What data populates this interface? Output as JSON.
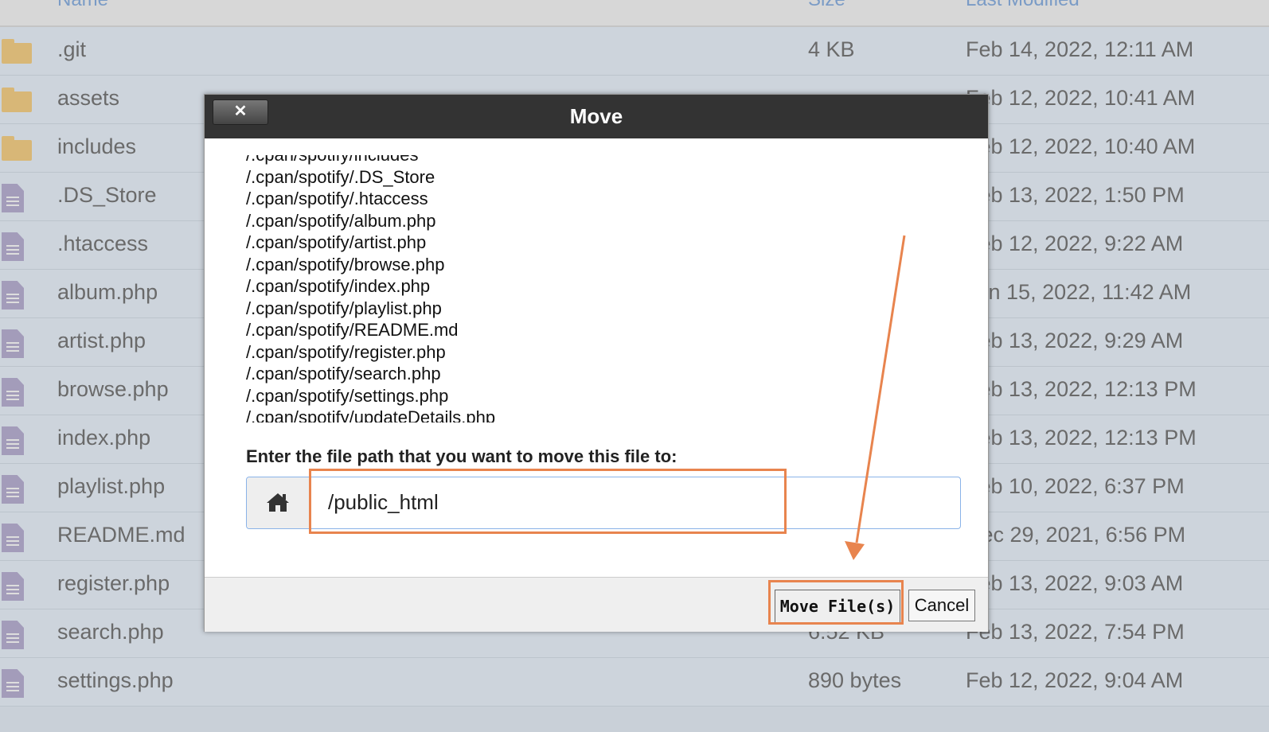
{
  "header": {
    "col_name": "Name",
    "col_size": "Size",
    "col_modified": "Last Modified"
  },
  "files": [
    {
      "type": "folder",
      "name": ".git",
      "size": "4 KB",
      "modified": "Feb 14, 2022, 12:11 AM"
    },
    {
      "type": "folder",
      "name": "assets",
      "size": "",
      "modified": "Feb 12, 2022, 10:41 AM"
    },
    {
      "type": "folder",
      "name": "includes",
      "size": "",
      "modified": "Feb 12, 2022, 10:40 AM"
    },
    {
      "type": "file",
      "name": ".DS_Store",
      "size": "",
      "modified": "Feb 13, 2022, 1:50 PM"
    },
    {
      "type": "file",
      "name": ".htaccess",
      "size": "",
      "modified": "Feb 12, 2022, 9:22 AM"
    },
    {
      "type": "file",
      "name": "album.php",
      "size": "",
      "modified": "Jan 15, 2022, 11:42 AM"
    },
    {
      "type": "file",
      "name": "artist.php",
      "size": "",
      "modified": "Feb 13, 2022, 9:29 AM"
    },
    {
      "type": "file",
      "name": "browse.php",
      "size": "",
      "modified": "Feb 13, 2022, 12:13 PM"
    },
    {
      "type": "file",
      "name": "index.php",
      "size": "",
      "modified": "Feb 13, 2022, 12:13 PM"
    },
    {
      "type": "file",
      "name": "playlist.php",
      "size": "",
      "modified": "Feb 10, 2022, 6:37 PM"
    },
    {
      "type": "file",
      "name": "README.md",
      "size": "",
      "modified": "Dec 29, 2021, 6:56 PM"
    },
    {
      "type": "file",
      "name": "register.php",
      "size": "",
      "modified": "Feb 13, 2022, 9:03 AM"
    },
    {
      "type": "file",
      "name": "search.php",
      "size": "6.52 KB",
      "modified": "Feb 13, 2022, 7:54 PM"
    },
    {
      "type": "file",
      "name": "settings.php",
      "size": "890 bytes",
      "modified": "Feb 12, 2022, 9:04 AM"
    }
  ],
  "dialog": {
    "title": "Move",
    "close_label": "✕",
    "paths": [
      "/.cpan/spotify/includes",
      "/.cpan/spotify/.DS_Store",
      "/.cpan/spotify/.htaccess",
      "/.cpan/spotify/album.php",
      "/.cpan/spotify/artist.php",
      "/.cpan/spotify/browse.php",
      "/.cpan/spotify/index.php",
      "/.cpan/spotify/playlist.php",
      "/.cpan/spotify/README.md",
      "/.cpan/spotify/register.php",
      "/.cpan/spotify/search.php",
      "/.cpan/spotify/settings.php",
      "/.cpan/spotify/updateDetails.php"
    ],
    "prompt": "Enter the file path that you want to move this file to:",
    "path_value": "/public_html",
    "move_label": "Move File(s)",
    "cancel_label": "Cancel"
  },
  "icons": {
    "home": "home-icon",
    "folder": "folder-icon",
    "file": "file-icon",
    "close": "close-icon"
  },
  "colors": {
    "annotation": "#e8844e",
    "titlebar": "#333333",
    "folder": "#d8b777",
    "file": "#a39cba"
  }
}
